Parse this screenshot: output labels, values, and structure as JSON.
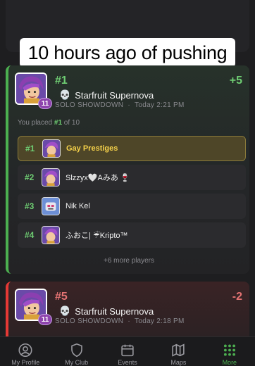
{
  "caption": "10 hours ago of pushing",
  "matches": [
    {
      "rank": "#1",
      "delta": "+5",
      "map": "Starfruit Supernova",
      "mode": "SOLO SHOWDOWN",
      "time": "Today 2:21 PM",
      "level": "11",
      "placed_prefix": "You placed ",
      "placed_rank": "#1",
      "placed_suffix": " of 10",
      "players": [
        {
          "pos": "#1",
          "name": "Gay Prestiges"
        },
        {
          "pos": "#2",
          "name": "Slzzyx🤍Aみあ 🍷"
        },
        {
          "pos": "#3",
          "name": "Nik Kel"
        },
        {
          "pos": "#4",
          "name": "ふおこ| ☔Kripto™"
        }
      ],
      "more": "+6 more players"
    },
    {
      "rank": "#5",
      "delta": "-2",
      "map": "Starfruit Supernova",
      "mode": "SOLO SHOWDOWN",
      "time": "Today 2:18 PM",
      "level": "11"
    }
  ],
  "tabs": [
    {
      "label": "My Profile",
      "icon": "profile-icon"
    },
    {
      "label": "My Club",
      "icon": "shield-icon"
    },
    {
      "label": "Events",
      "icon": "calendar-icon"
    },
    {
      "label": "Maps",
      "icon": "map-icon"
    },
    {
      "label": "More",
      "icon": "grid-dots-icon"
    }
  ],
  "colors": {
    "win": "#4caf50",
    "loss": "#e57373",
    "highlight": "#f6d24a"
  }
}
